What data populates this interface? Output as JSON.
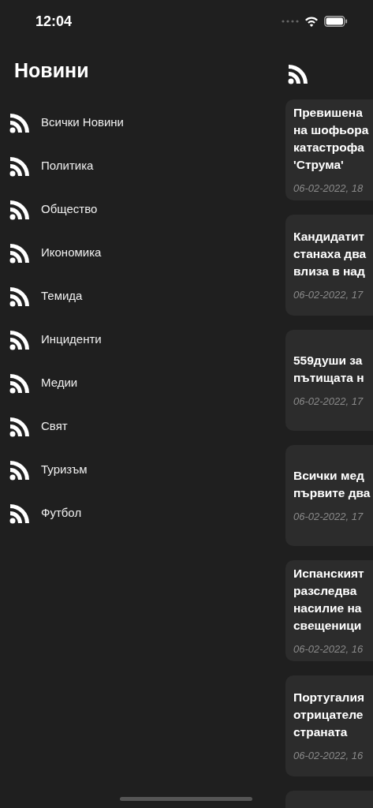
{
  "status_bar": {
    "time": "12:04"
  },
  "sidebar": {
    "title": "Новини",
    "items": [
      {
        "label": "Всички Новини"
      },
      {
        "label": "Политика"
      },
      {
        "label": "Общество"
      },
      {
        "label": "Икономика"
      },
      {
        "label": "Темида"
      },
      {
        "label": "Инциденти"
      },
      {
        "label": "Медии"
      },
      {
        "label": "Свят"
      },
      {
        "label": "Туризъм"
      },
      {
        "label": "Футбол"
      }
    ]
  },
  "articles": [
    {
      "title_lines": [
        "Превишена",
        "на шофьора",
        "катастрофа",
        "'Струма'"
      ],
      "date": "06-02-2022, 18"
    },
    {
      "title_lines": [
        "Кандидатит",
        "станаха два",
        "влиза в над"
      ],
      "date": "06-02-2022, 17"
    },
    {
      "title_lines": [
        "559души за",
        "пътищата н"
      ],
      "date": "06-02-2022, 17"
    },
    {
      "title_lines": [
        "Всички мед",
        "първите два"
      ],
      "date": "06-02-2022, 17"
    },
    {
      "title_lines": [
        "Испанският",
        "разследва",
        "насилие на",
        "свещеници"
      ],
      "date": "06-02-2022, 16"
    },
    {
      "title_lines": [
        "Португалия",
        "отрицателе",
        "страната"
      ],
      "date": "06-02-2022, 16"
    }
  ]
}
